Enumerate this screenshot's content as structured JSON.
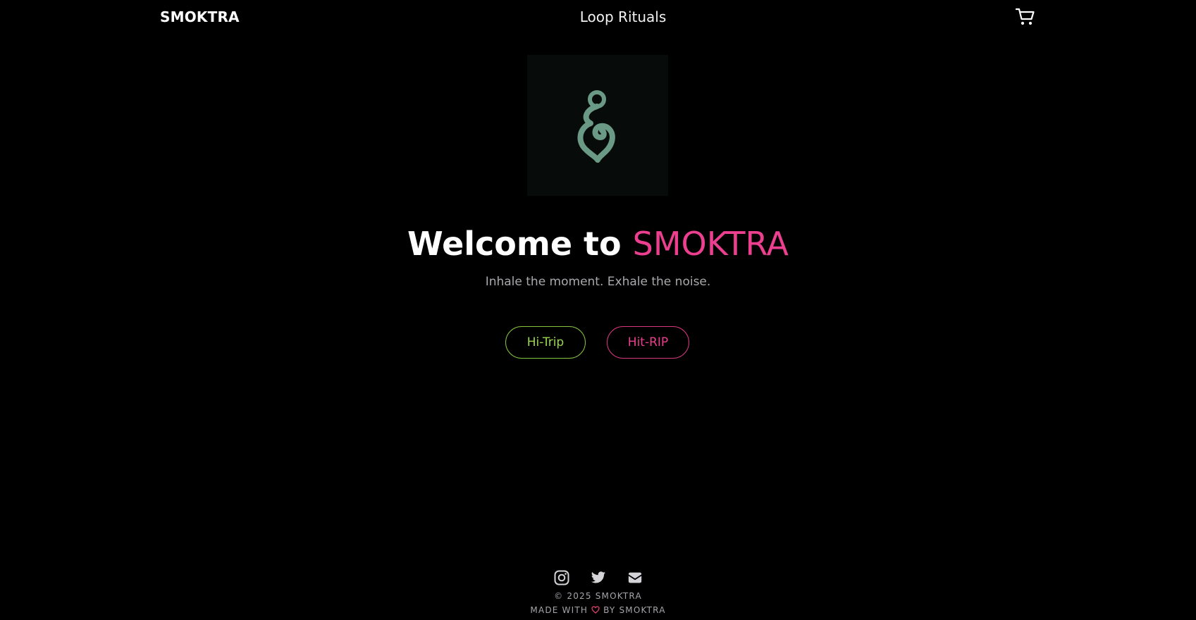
{
  "header": {
    "brand": "SMOKTRA",
    "nav_title": "Loop Rituals",
    "cart_icon": "shopping-cart-icon"
  },
  "hero": {
    "logo_icon": "swirl-hook-logo",
    "title_prefix": "Welcome to",
    "title_brand": "SMOKTRA",
    "tagline": "Inhale the moment. Exhale the noise.",
    "buttons": [
      {
        "label": "Hi-Trip",
        "color": "#9bd64c"
      },
      {
        "label": "Hit-RIP",
        "color": "#ec3f8f"
      }
    ]
  },
  "footer": {
    "socials": [
      "instagram-icon",
      "twitter-icon",
      "email-icon"
    ],
    "copyright": "© 2025 SMOKTRA",
    "made_with_prefix": "MADE WITH",
    "made_with_suffix": "BY SMOKTRA",
    "heart_icon": "heart-icon"
  },
  "colors": {
    "background": "#000000",
    "accent_pink": "#ec3f8f",
    "accent_green": "#9bd64c",
    "logo_green": "#6a9a86"
  }
}
